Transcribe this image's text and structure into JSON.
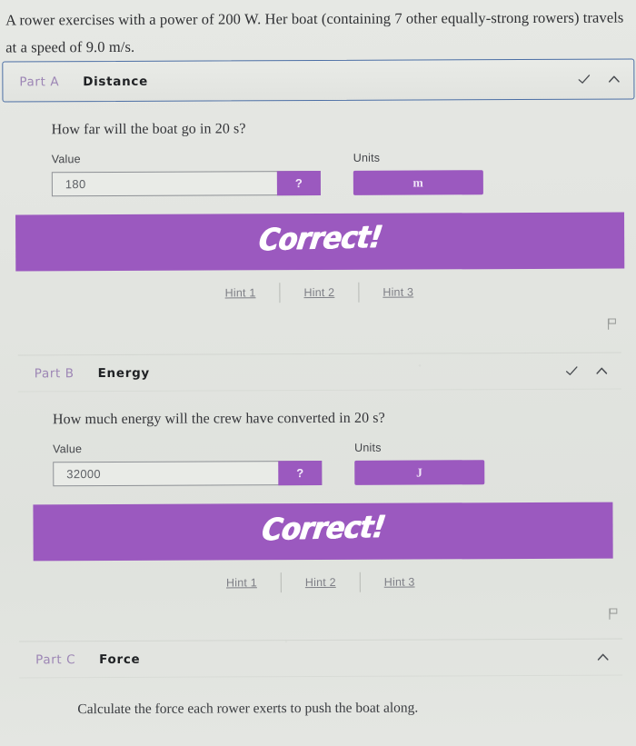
{
  "problem": {
    "line1": "A rower exercises with a power of 200 W. Her boat (containing 7 other equally-strong rowers) travels",
    "line2": "at a speed of 9.0 m/s."
  },
  "colors": {
    "accent_purple": "#9b59bf",
    "page_background": "#e3e5e1",
    "focus_border_blue": "#4c6fa5",
    "part_label_mauve": "#9d86b5"
  },
  "parts": [
    {
      "label": "Part A",
      "title": "Distance",
      "state": "active",
      "has_check": true,
      "chevron": "chevron-up",
      "question": "How far will the boat go in 20 s?",
      "value_label": "Value",
      "value": "180",
      "help_label": "?",
      "units_label": "Units",
      "units_value": "m",
      "feedback": "Correct!",
      "hints": [
        "Hint 1",
        "Hint 2",
        "Hint 3"
      ],
      "flag_icon": "flag-icon"
    },
    {
      "label": "Part B",
      "title": "Energy",
      "state": "plain",
      "has_check": true,
      "chevron": "chevron-up",
      "question": "How much energy will the crew have converted in 20 s?",
      "value_label": "Value",
      "value": "32000",
      "help_label": "?",
      "units_label": "Units",
      "units_value": "J",
      "feedback": "Correct!",
      "hints": [
        "Hint 1",
        "Hint 2",
        "Hint 3"
      ],
      "flag_icon": "flag-icon"
    },
    {
      "label": "Part C",
      "title": "Force",
      "state": "plain",
      "has_check": false,
      "chevron": "chevron-up",
      "question": "Calculate the force each rower exerts to push the boat along."
    }
  ]
}
